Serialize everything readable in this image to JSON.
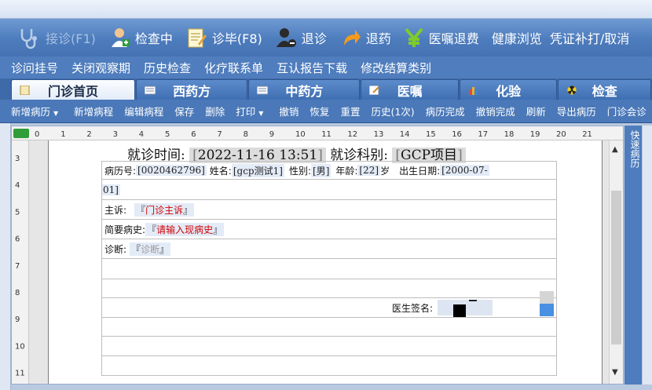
{
  "toolbar": {
    "buttons": [
      {
        "label": "接诊(F1)",
        "icon": "stethoscope-icon",
        "disabled": true
      },
      {
        "label": "检查中",
        "icon": "doctor-icon",
        "disabled": false
      },
      {
        "label": "诊毕(F8)",
        "icon": "notepad-icon",
        "disabled": false
      },
      {
        "label": "退诊",
        "icon": "user-remove-icon",
        "disabled": false
      },
      {
        "label": "退药",
        "icon": "return-arrow-icon",
        "disabled": false
      },
      {
        "label": "医嘱退费",
        "icon": "yen-icon",
        "disabled": false
      },
      {
        "label": "健康浏览",
        "icon": "",
        "disabled": false
      },
      {
        "label": "凭证补打/取消",
        "icon": "",
        "disabled": false
      }
    ]
  },
  "menu": [
    "诊问挂号",
    "关闭观察期",
    "历史检查",
    "化疗联系单",
    "互认报告下载",
    "修改结算类别"
  ],
  "tabs": [
    {
      "label": "门诊首页",
      "active": true
    },
    {
      "label": "西药方",
      "active": false
    },
    {
      "label": "中药方",
      "active": false
    },
    {
      "label": "医嘱",
      "active": false
    },
    {
      "label": "化验",
      "active": false
    },
    {
      "label": "检查",
      "active": false
    }
  ],
  "subtoolbar": [
    "新增病历",
    "新增病程",
    "编辑病程",
    "保存",
    "删除",
    "打印",
    "撤销",
    "恢复",
    "重置",
    "历史(1次)",
    "病历完成",
    "撤销完成",
    "刷新",
    "导出病历",
    "门诊会诊"
  ],
  "ruler": {
    "h_ticks": [
      "0",
      "1",
      "2",
      "3",
      "4",
      "5",
      "6",
      "7",
      "8",
      "9",
      "10",
      "11",
      "12",
      "13",
      "14",
      "15",
      "16",
      "17",
      "18",
      "19",
      "20",
      "21"
    ],
    "v_ticks": [
      "3",
      "4",
      "5",
      "6",
      "7",
      "8",
      "9",
      "10",
      "11"
    ]
  },
  "document": {
    "visit_time_label": "就诊时间:",
    "visit_time": "2022-11-16 13:51",
    "dept_label": "就诊科别:",
    "dept": "GCP项目",
    "record_no_label": "病历号:",
    "record_no": "0020462796",
    "name_label": "姓名:",
    "name": "gcp测试1",
    "gender_label": "性别:",
    "gender": "男",
    "age_label": "年龄:",
    "age": "22",
    "age_unit": "岁",
    "dob_label": "出生日期:",
    "dob_part1": "[2000-07-",
    "dob_part2": "01]",
    "complaint_label": "主诉:",
    "complaint": "门诊主诉",
    "history_label": "简要病史:",
    "history": "请输入现病史",
    "diagnosis_label": "诊断:",
    "diagnosis": "诊断",
    "signature_label": "医生签名:"
  },
  "side_panel": {
    "label": "快速病历"
  }
}
